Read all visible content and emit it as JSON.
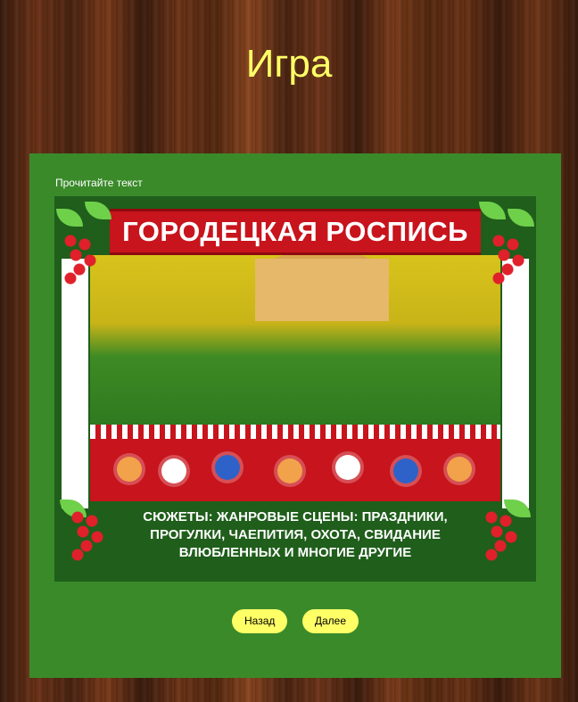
{
  "header": {
    "title": "Игра"
  },
  "panel": {
    "instruction": "Прочитайте текст"
  },
  "poster": {
    "banner": "ГОРОДЕЦКАЯ РОСПИСЬ",
    "caption_lines": [
      "СЮЖЕТЫ: ЖАНРОВЫЕ СЦЕНЫ: ПРАЗДНИКИ,",
      "ПРОГУЛКИ, ЧАЕПИТИЯ, ОХОТА, СВИДАНИЕ",
      "ВЛЮБЛЕННЫХ И МНОГИЕ ДРУГИЕ"
    ]
  },
  "navigation": {
    "back_label": "Назад",
    "next_label": "Далее"
  },
  "colors": {
    "title": "#ffff66",
    "panel": "#3a8a2a",
    "button": "#ffff66"
  }
}
